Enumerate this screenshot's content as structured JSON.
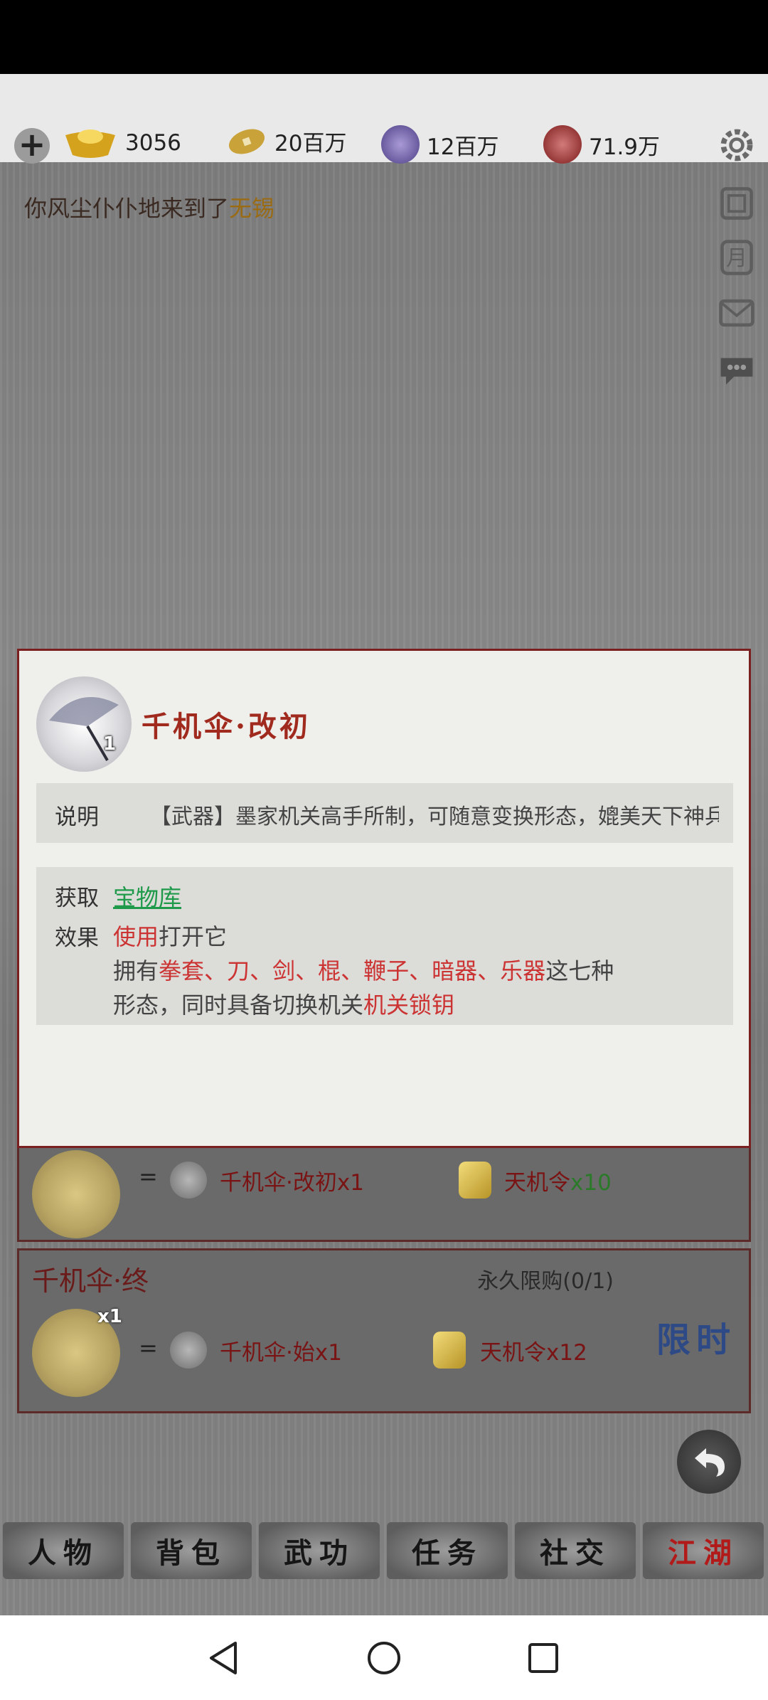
{
  "resources": [
    {
      "icon": "gold-ingot-icon",
      "value": "3056"
    },
    {
      "icon": "copper-coin-icon",
      "value": "20百万"
    },
    {
      "icon": "potential-orb-icon",
      "value": "12百万"
    },
    {
      "icon": "cultivation-orb-icon",
      "value": "71.9万"
    }
  ],
  "message": {
    "prefix": "你风尘仆仆地来到了",
    "city": "无锡"
  },
  "modal": {
    "count": "1",
    "title": "千机伞·改初",
    "desc_label": "说明",
    "desc": "【武器】墨家机关高手所制，可随意变换形态，媲美天下神兵",
    "obtain_label": "获取",
    "obtain_link": "宝物库",
    "effect_label": "效果",
    "effect_use": "使用",
    "effect_use_rest": "打开它",
    "effect_line2_a": "拥有",
    "effect_weapons": [
      "拳套",
      "刀",
      "剑",
      "棍",
      "鞭子",
      "暗器",
      "乐器"
    ],
    "effect_sep": "、",
    "effect_line2_b": "这七种",
    "effect_line3_a": "形态，同时具备切换机关",
    "effect_line3_b": "机关锁钥"
  },
  "card1": {
    "eq": "=",
    "item1": "千机伞·改初x1",
    "item2_name": "天机令",
    "item2_qty": "x10"
  },
  "card2": {
    "title": "千机伞·终",
    "limit": "永久限购(0/1)",
    "count": "x1",
    "eq": "=",
    "item1": "千机伞·始x1",
    "item2": "天机令x12",
    "badge": "限时"
  },
  "tabs": [
    "人物",
    "背包",
    "武功",
    "任务",
    "社交",
    "江湖"
  ]
}
